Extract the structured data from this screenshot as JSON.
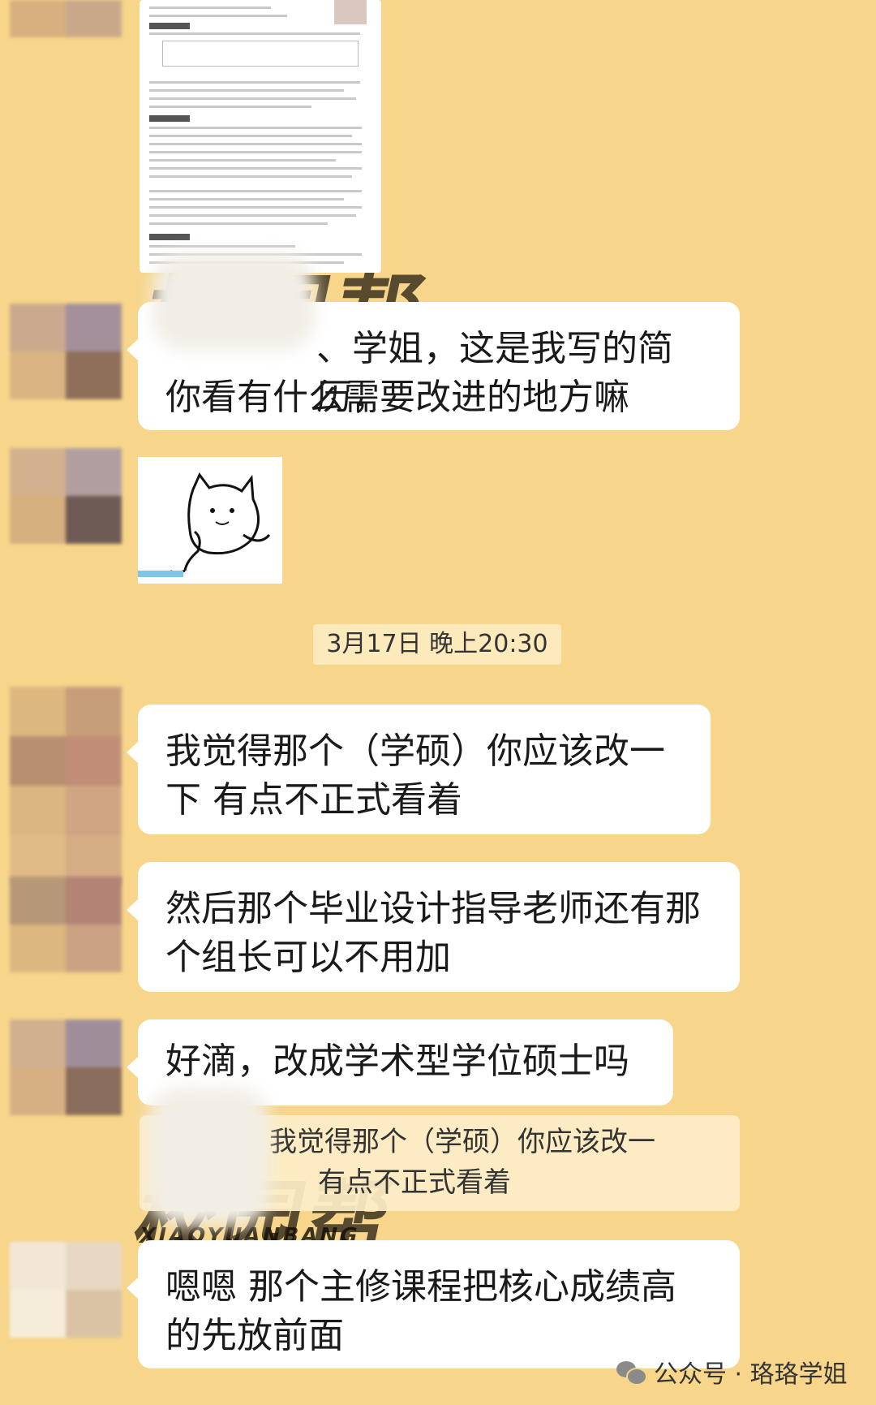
{
  "watermark": {
    "main_text": "校园帮",
    "sub_text": "XIAOYUANBANG"
  },
  "colors": {
    "background": "#F7D68B",
    "bubble": "#FFFFFF",
    "text": "#1a1a1a",
    "timestamp_bg": "#FCE9BC"
  },
  "messages": [
    {
      "line1": "、学姐，这是我写的简历，",
      "line2": "你看有什么需要改进的地方嘛"
    },
    {
      "line1": "我觉得那个（学硕）你应该改一",
      "line2": "下 有点不正式看着"
    },
    {
      "line1": "然后那个毕业设计指导老师还有那",
      "line2": "个组长可以不用加"
    },
    {
      "line1": "好滴，改成学术型学位硕士吗"
    },
    {
      "line1": "嗯嗯 那个主修课程把核心成绩高",
      "line2": "的先放前面"
    }
  ],
  "timestamp": "3月17日 晚上20:30",
  "quoted_reply": {
    "line1": "我觉得那个（学硕）你应该改一",
    "line2": "有点不正式看着"
  },
  "footer": {
    "icon": "wechat-icon",
    "label": "公众号 · 珞珞学姐"
  }
}
